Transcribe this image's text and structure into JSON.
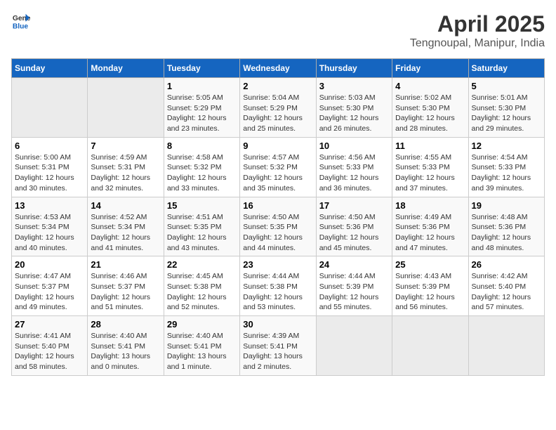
{
  "logo": {
    "general": "General",
    "blue": "Blue"
  },
  "title": "April 2025",
  "subtitle": "Tengnoupal, Manipur, India",
  "headers": [
    "Sunday",
    "Monday",
    "Tuesday",
    "Wednesday",
    "Thursday",
    "Friday",
    "Saturday"
  ],
  "weeks": [
    [
      {
        "day": "",
        "sunrise": "",
        "sunset": "",
        "daylight": "",
        "empty": true
      },
      {
        "day": "",
        "sunrise": "",
        "sunset": "",
        "daylight": "",
        "empty": true
      },
      {
        "day": "1",
        "sunrise": "Sunrise: 5:05 AM",
        "sunset": "Sunset: 5:29 PM",
        "daylight": "Daylight: 12 hours and 23 minutes."
      },
      {
        "day": "2",
        "sunrise": "Sunrise: 5:04 AM",
        "sunset": "Sunset: 5:29 PM",
        "daylight": "Daylight: 12 hours and 25 minutes."
      },
      {
        "day": "3",
        "sunrise": "Sunrise: 5:03 AM",
        "sunset": "Sunset: 5:30 PM",
        "daylight": "Daylight: 12 hours and 26 minutes."
      },
      {
        "day": "4",
        "sunrise": "Sunrise: 5:02 AM",
        "sunset": "Sunset: 5:30 PM",
        "daylight": "Daylight: 12 hours and 28 minutes."
      },
      {
        "day": "5",
        "sunrise": "Sunrise: 5:01 AM",
        "sunset": "Sunset: 5:30 PM",
        "daylight": "Daylight: 12 hours and 29 minutes."
      }
    ],
    [
      {
        "day": "6",
        "sunrise": "Sunrise: 5:00 AM",
        "sunset": "Sunset: 5:31 PM",
        "daylight": "Daylight: 12 hours and 30 minutes."
      },
      {
        "day": "7",
        "sunrise": "Sunrise: 4:59 AM",
        "sunset": "Sunset: 5:31 PM",
        "daylight": "Daylight: 12 hours and 32 minutes."
      },
      {
        "day": "8",
        "sunrise": "Sunrise: 4:58 AM",
        "sunset": "Sunset: 5:32 PM",
        "daylight": "Daylight: 12 hours and 33 minutes."
      },
      {
        "day": "9",
        "sunrise": "Sunrise: 4:57 AM",
        "sunset": "Sunset: 5:32 PM",
        "daylight": "Daylight: 12 hours and 35 minutes."
      },
      {
        "day": "10",
        "sunrise": "Sunrise: 4:56 AM",
        "sunset": "Sunset: 5:33 PM",
        "daylight": "Daylight: 12 hours and 36 minutes."
      },
      {
        "day": "11",
        "sunrise": "Sunrise: 4:55 AM",
        "sunset": "Sunset: 5:33 PM",
        "daylight": "Daylight: 12 hours and 37 minutes."
      },
      {
        "day": "12",
        "sunrise": "Sunrise: 4:54 AM",
        "sunset": "Sunset: 5:33 PM",
        "daylight": "Daylight: 12 hours and 39 minutes."
      }
    ],
    [
      {
        "day": "13",
        "sunrise": "Sunrise: 4:53 AM",
        "sunset": "Sunset: 5:34 PM",
        "daylight": "Daylight: 12 hours and 40 minutes."
      },
      {
        "day": "14",
        "sunrise": "Sunrise: 4:52 AM",
        "sunset": "Sunset: 5:34 PM",
        "daylight": "Daylight: 12 hours and 41 minutes."
      },
      {
        "day": "15",
        "sunrise": "Sunrise: 4:51 AM",
        "sunset": "Sunset: 5:35 PM",
        "daylight": "Daylight: 12 hours and 43 minutes."
      },
      {
        "day": "16",
        "sunrise": "Sunrise: 4:50 AM",
        "sunset": "Sunset: 5:35 PM",
        "daylight": "Daylight: 12 hours and 44 minutes."
      },
      {
        "day": "17",
        "sunrise": "Sunrise: 4:50 AM",
        "sunset": "Sunset: 5:36 PM",
        "daylight": "Daylight: 12 hours and 45 minutes."
      },
      {
        "day": "18",
        "sunrise": "Sunrise: 4:49 AM",
        "sunset": "Sunset: 5:36 PM",
        "daylight": "Daylight: 12 hours and 47 minutes."
      },
      {
        "day": "19",
        "sunrise": "Sunrise: 4:48 AM",
        "sunset": "Sunset: 5:36 PM",
        "daylight": "Daylight: 12 hours and 48 minutes."
      }
    ],
    [
      {
        "day": "20",
        "sunrise": "Sunrise: 4:47 AM",
        "sunset": "Sunset: 5:37 PM",
        "daylight": "Daylight: 12 hours and 49 minutes."
      },
      {
        "day": "21",
        "sunrise": "Sunrise: 4:46 AM",
        "sunset": "Sunset: 5:37 PM",
        "daylight": "Daylight: 12 hours and 51 minutes."
      },
      {
        "day": "22",
        "sunrise": "Sunrise: 4:45 AM",
        "sunset": "Sunset: 5:38 PM",
        "daylight": "Daylight: 12 hours and 52 minutes."
      },
      {
        "day": "23",
        "sunrise": "Sunrise: 4:44 AM",
        "sunset": "Sunset: 5:38 PM",
        "daylight": "Daylight: 12 hours and 53 minutes."
      },
      {
        "day": "24",
        "sunrise": "Sunrise: 4:44 AM",
        "sunset": "Sunset: 5:39 PM",
        "daylight": "Daylight: 12 hours and 55 minutes."
      },
      {
        "day": "25",
        "sunrise": "Sunrise: 4:43 AM",
        "sunset": "Sunset: 5:39 PM",
        "daylight": "Daylight: 12 hours and 56 minutes."
      },
      {
        "day": "26",
        "sunrise": "Sunrise: 4:42 AM",
        "sunset": "Sunset: 5:40 PM",
        "daylight": "Daylight: 12 hours and 57 minutes."
      }
    ],
    [
      {
        "day": "27",
        "sunrise": "Sunrise: 4:41 AM",
        "sunset": "Sunset: 5:40 PM",
        "daylight": "Daylight: 12 hours and 58 minutes."
      },
      {
        "day": "28",
        "sunrise": "Sunrise: 4:40 AM",
        "sunset": "Sunset: 5:41 PM",
        "daylight": "Daylight: 13 hours and 0 minutes."
      },
      {
        "day": "29",
        "sunrise": "Sunrise: 4:40 AM",
        "sunset": "Sunset: 5:41 PM",
        "daylight": "Daylight: 13 hours and 1 minute."
      },
      {
        "day": "30",
        "sunrise": "Sunrise: 4:39 AM",
        "sunset": "Sunset: 5:41 PM",
        "daylight": "Daylight: 13 hours and 2 minutes."
      },
      {
        "day": "",
        "sunrise": "",
        "sunset": "",
        "daylight": "",
        "empty": true
      },
      {
        "day": "",
        "sunrise": "",
        "sunset": "",
        "daylight": "",
        "empty": true
      },
      {
        "day": "",
        "sunrise": "",
        "sunset": "",
        "daylight": "",
        "empty": true
      }
    ]
  ]
}
